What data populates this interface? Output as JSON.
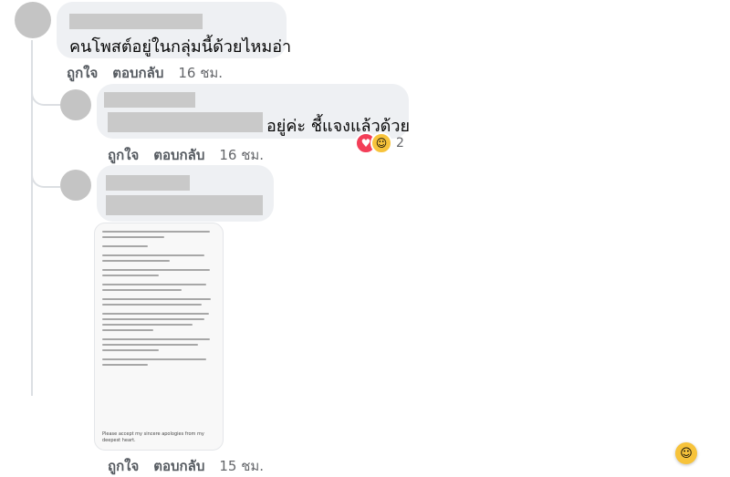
{
  "comment1": {
    "text": "คนโพสต์อยู่ในกลุ่มนี้ด้วยไหมอ่า",
    "like_label": "ถูกใจ",
    "reply_label": "ตอบกลับ",
    "time": "16 ชม."
  },
  "reply1": {
    "text_visible": "อยู่ค่ะ ชี้แจงแล้วด้วย",
    "like_label": "ถูกใจ",
    "reply_label": "ตอบกลับ",
    "time": "16 ชม.",
    "reactions": {
      "icons": [
        "love-icon",
        "care-icon"
      ],
      "count": "2"
    }
  },
  "reply2": {
    "like_label": "ถูกใจ",
    "reply_label": "ตอบกลับ",
    "time": "15 ชม.",
    "image_caption": "Please accept my sincere apologies from my deepest heart."
  },
  "colors": {
    "bubble": "#eef0f3",
    "redaction": "#c9c9c9",
    "action_text": "#65676b",
    "love": "#f33e58",
    "care": "#f7c33b"
  }
}
